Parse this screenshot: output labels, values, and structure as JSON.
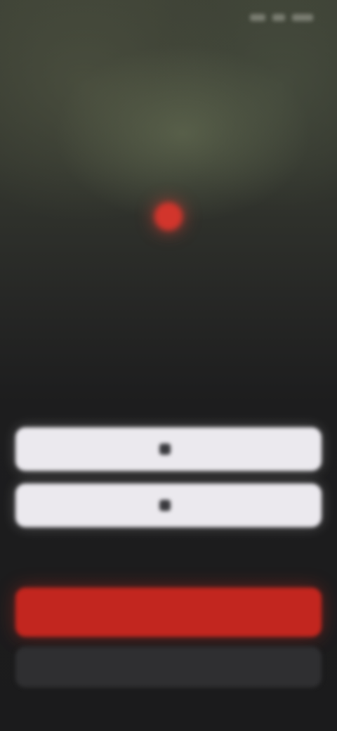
{
  "status_bar": {
    "time": "",
    "icons": [
      "signal-icon",
      "wifi-icon",
      "battery-icon"
    ]
  },
  "branding": {
    "wordmark": "",
    "tagline": ""
  },
  "auth": {
    "provider_one_label": "",
    "provider_two_label": "",
    "divider_label": "",
    "primary_label": "",
    "secondary_label": ""
  },
  "colors": {
    "accent": "#c2261f",
    "light_button": "#ebe9ee",
    "secondary_button": "#2f2f31",
    "background": "#1b1b1c"
  }
}
